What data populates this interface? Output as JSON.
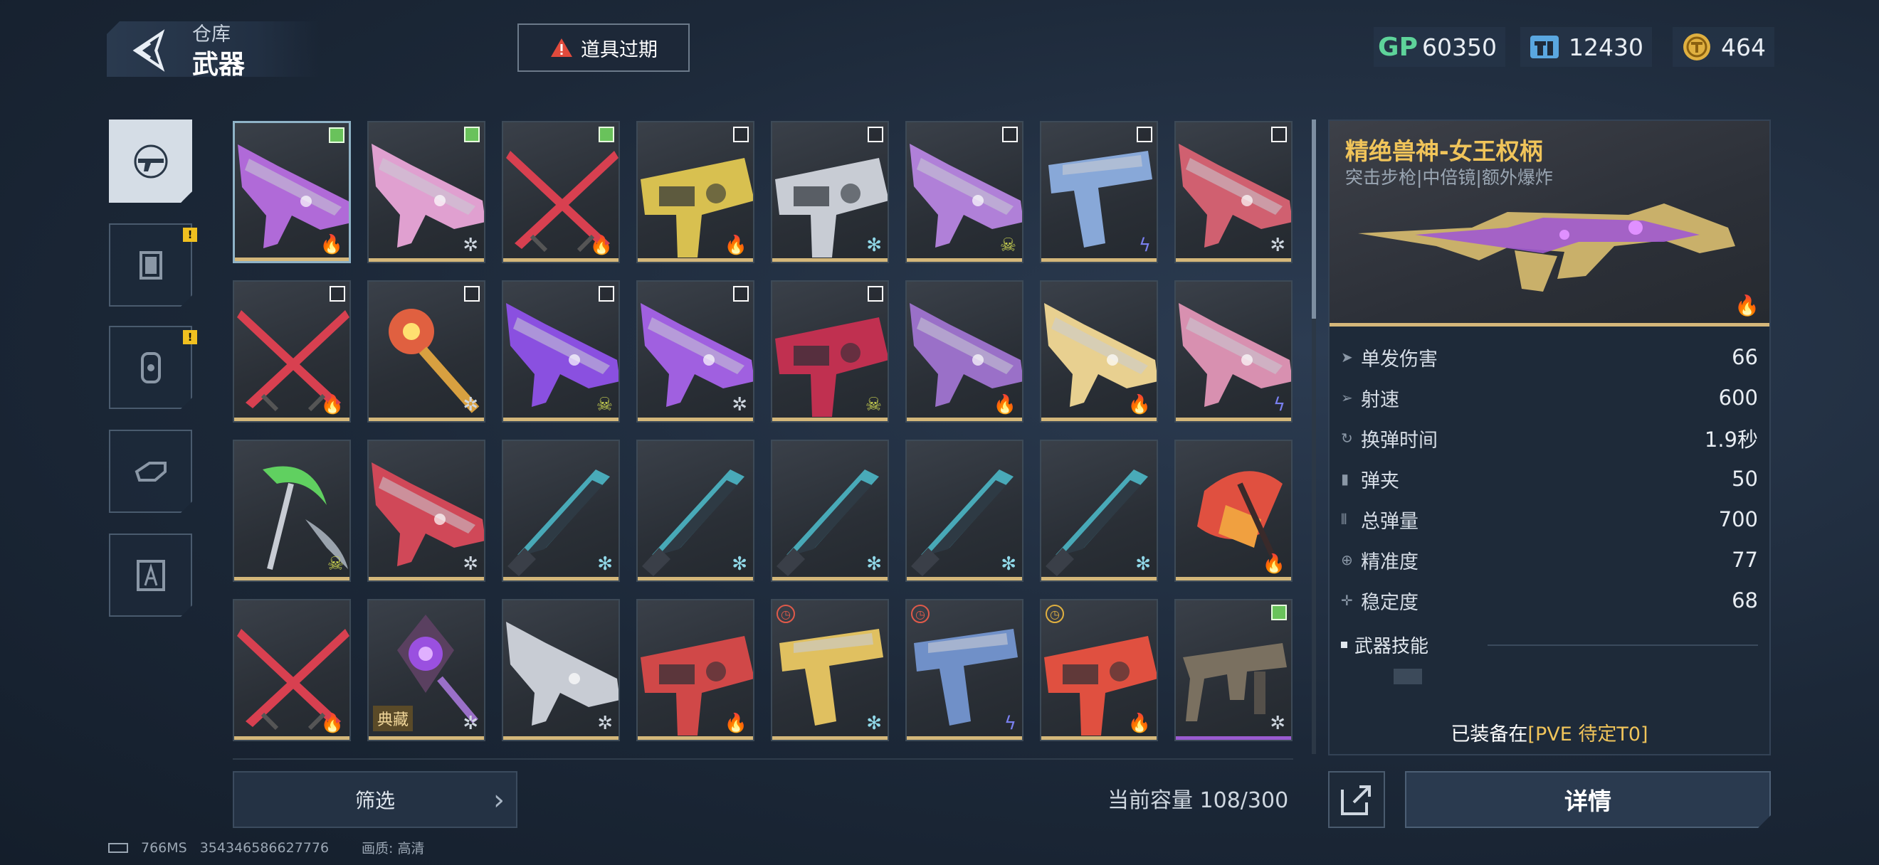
{
  "header": {
    "parent": "仓库",
    "title": "武器",
    "expired_label": "道具过期"
  },
  "currency": [
    {
      "icon": "gp-icon",
      "label": "GP",
      "value": "60350",
      "color": "#5ed39a"
    },
    {
      "icon": "ticket-icon",
      "label": "",
      "value": "12430",
      "color": "#5aa7e0"
    },
    {
      "icon": "gold-coin-icon",
      "label": "",
      "value": "464",
      "color": "#e0b040"
    }
  ],
  "categories": [
    {
      "name": "gun-category-icon",
      "active": true,
      "badge": ""
    },
    {
      "name": "frame-category-icon",
      "active": false,
      "badge": "!"
    },
    {
      "name": "grenade-category-icon",
      "active": false,
      "badge": "!"
    },
    {
      "name": "hand-category-icon",
      "active": false,
      "badge": ""
    },
    {
      "name": "blueprint-category-icon",
      "active": false,
      "badge": ""
    }
  ],
  "items": [
    {
      "type": "rifle",
      "hue": "#b06ad8",
      "rarity": "fire",
      "check": "on",
      "selected": true
    },
    {
      "type": "rifle",
      "hue": "#e0a0d0",
      "rarity": "star",
      "check": "on"
    },
    {
      "type": "blade-x",
      "hue": "#d84050",
      "rarity": "fire",
      "check": "on"
    },
    {
      "type": "heavy",
      "hue": "#d8c050",
      "rarity": "fire",
      "check": "off"
    },
    {
      "type": "heavy",
      "hue": "#c8ccd4",
      "rarity": "snow",
      "check": "off"
    },
    {
      "type": "rifle",
      "hue": "#b080d8",
      "rarity": "skull",
      "check": "off"
    },
    {
      "type": "pistol",
      "hue": "#88a8d8",
      "rarity": "bolt",
      "check": "off"
    },
    {
      "type": "rifle",
      "hue": "#d06070",
      "rarity": "star",
      "check": "off"
    },
    {
      "type": "blade-x",
      "hue": "#d84050",
      "rarity": "fire",
      "check": "off"
    },
    {
      "type": "staff",
      "hue": "#e06040",
      "rarity": "star",
      "check": "off"
    },
    {
      "type": "rifle",
      "hue": "#8a50e0",
      "rarity": "skull",
      "check": "off"
    },
    {
      "type": "rifle",
      "hue": "#a060e0",
      "rarity": "star",
      "check": "off"
    },
    {
      "type": "heavy",
      "hue": "#c03050",
      "rarity": "skull",
      "check": "off"
    },
    {
      "type": "rifle",
      "hue": "#9a70c8",
      "rarity": "fire",
      "check": "none"
    },
    {
      "type": "rifle",
      "hue": "#e8d090",
      "rarity": "fire",
      "check": "none"
    },
    {
      "type": "rifle",
      "hue": "#d890b0",
      "rarity": "bolt",
      "check": "none"
    },
    {
      "type": "scythe",
      "hue": "#60d060",
      "rarity": "skull",
      "check": "none"
    },
    {
      "type": "rifle",
      "hue": "#d04858",
      "rarity": "star",
      "check": "none"
    },
    {
      "type": "knife",
      "hue": "#50c8d8",
      "rarity": "snow",
      "check": "none"
    },
    {
      "type": "knife",
      "hue": "#50c8d8",
      "rarity": "snow",
      "check": "none"
    },
    {
      "type": "knife",
      "hue": "#50c8d8",
      "rarity": "snow",
      "check": "none"
    },
    {
      "type": "knife",
      "hue": "#50c8d8",
      "rarity": "snow",
      "check": "none"
    },
    {
      "type": "knife",
      "hue": "#50c8d8",
      "rarity": "snow",
      "check": "none"
    },
    {
      "type": "axe",
      "hue": "#e05040",
      "rarity": "fire",
      "check": "none"
    },
    {
      "type": "blade-x",
      "hue": "#d84050",
      "rarity": "fire",
      "check": "none"
    },
    {
      "type": "orb",
      "hue": "#9a50e0",
      "rarity": "star",
      "check": "none",
      "tag": "典藏"
    },
    {
      "type": "rifle",
      "hue": "#c8ccd4",
      "rarity": "star",
      "check": "none"
    },
    {
      "type": "heavy",
      "hue": "#d04848",
      "rarity": "fire",
      "check": "none"
    },
    {
      "type": "pistol",
      "hue": "#e0c060",
      "rarity": "snow",
      "check": "none",
      "clock": "red"
    },
    {
      "type": "pistol",
      "hue": "#7090c8",
      "rarity": "bolt",
      "check": "none",
      "clock": "red"
    },
    {
      "type": "heavy",
      "hue": "#e05040",
      "rarity": "fire",
      "check": "none",
      "clock": "gold"
    },
    {
      "type": "smg",
      "hue": "#7a7060",
      "rarity": "star",
      "check": "on",
      "purple": true
    }
  ],
  "detail": {
    "name": "精绝兽神-女王权柄",
    "subtitle": "突击步枪|中倍镜|额外爆炸",
    "stats": [
      {
        "label": "单发伤害",
        "value": "66",
        "icon": "damage-icon"
      },
      {
        "label": "射速",
        "value": "600",
        "icon": "fire-rate-icon"
      },
      {
        "label": "换弹时间",
        "value": "1.9秒",
        "icon": "reload-icon"
      },
      {
        "label": "弹夹",
        "value": "50",
        "icon": "magazine-icon"
      },
      {
        "label": "总弹量",
        "value": "700",
        "icon": "ammo-icon"
      },
      {
        "label": "精准度",
        "value": "77",
        "icon": "accuracy-icon"
      },
      {
        "label": "稳定度",
        "value": "68",
        "icon": "stability-icon"
      }
    ],
    "skill_title": "武器技能",
    "equipped_prefix": "已装备在",
    "equipped_target": "[PVE 待定T0]"
  },
  "bottom": {
    "filter_label": "筛选",
    "capacity": "当前容量 108/300",
    "detail_label": "详情"
  },
  "status": {
    "ping": "766MS",
    "uid": "354346586627776",
    "quality": "画质: 高清"
  }
}
